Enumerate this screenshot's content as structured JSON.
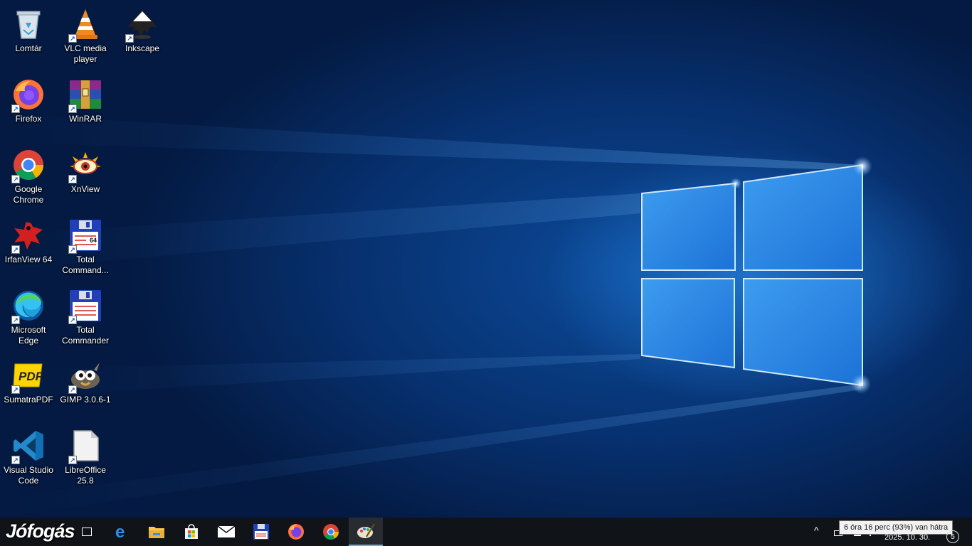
{
  "desktop": {
    "icons": [
      {
        "label": "Lomtár",
        "icon": "recycle-bin-icon"
      },
      {
        "label": "VLC media player",
        "icon": "vlc-icon"
      },
      {
        "label": "Inkscape",
        "icon": "inkscape-icon"
      },
      {
        "label": "Firefox",
        "icon": "firefox-icon"
      },
      {
        "label": "WinRAR",
        "icon": "winrar-icon"
      },
      {
        "label": "Google Chrome",
        "icon": "chrome-icon"
      },
      {
        "label": "XnView",
        "icon": "xnview-icon"
      },
      {
        "label": "IrfanView 64",
        "icon": "irfanview-icon"
      },
      {
        "label": "Total Command...",
        "icon": "total-commander-64-icon"
      },
      {
        "label": "Microsoft Edge",
        "icon": "edge-icon"
      },
      {
        "label": "Total Commander",
        "icon": "total-commander-icon"
      },
      {
        "label": "SumatraPDF",
        "icon": "sumatrapdf-icon"
      },
      {
        "label": "GIMP 3.0.6-1",
        "icon": "gimp-icon"
      },
      {
        "label": "Visual Studio Code",
        "icon": "vscode-icon"
      },
      {
        "label": "LibreOffice 25.8",
        "icon": "libreoffice-icon"
      }
    ],
    "tc64_badge": "64"
  },
  "watermark": "Jófogás",
  "taskbar": {
    "pinned": [
      {
        "name": "task-view",
        "icon": "task-view-icon"
      },
      {
        "name": "edge",
        "icon": "edge-icon"
      },
      {
        "name": "file-explorer",
        "icon": "folder-icon"
      },
      {
        "name": "microsoft-store",
        "icon": "store-icon"
      },
      {
        "name": "mail",
        "icon": "mail-icon"
      },
      {
        "name": "total-commander",
        "icon": "floppy-icon"
      },
      {
        "name": "firefox",
        "icon": "firefox-icon"
      },
      {
        "name": "chrome",
        "icon": "chrome-icon"
      },
      {
        "name": "paint",
        "icon": "paint-palette-icon"
      }
    ],
    "tray": {
      "tooltip": "6 óra 16 perc (93%) van hátra",
      "date": "2025. 10. 30.",
      "notification_count": "5",
      "chevron": "^"
    }
  },
  "colors": {
    "taskbar": "#101418",
    "wallpaper_accent": "#2b8fe6",
    "active_indicator": "#6aa9e6"
  }
}
